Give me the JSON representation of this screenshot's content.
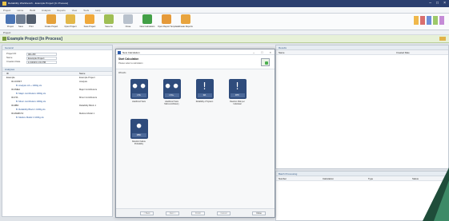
{
  "window": {
    "title": "Reliability Workbench - Example Project [In Process]",
    "controls": [
      "–",
      "□",
      "×"
    ]
  },
  "menu": [
    "Project",
    "Home",
    "Build",
    "Analysis",
    "Reports",
    "View",
    "Tools",
    "Help"
  ],
  "ribbon": {
    "buttons": [
      {
        "label": "Project",
        "color": "#4a74b4"
      },
      {
        "label": "Save",
        "color": "#6f7e92"
      },
      {
        "label": "Print",
        "color": "#545f6e"
      },
      {
        "label": "Create Project",
        "color": "#e5a23b"
      },
      {
        "label": "Open Project",
        "color": "#e3b84a"
      },
      {
        "label": "Save Project",
        "color": "#f0a93b"
      },
      {
        "label": "Save As",
        "color": "#9fbf55"
      },
      {
        "label": "Close",
        "color": "#b9c2cd"
      },
      {
        "label": "New Calculation",
        "color": "#43a047"
      },
      {
        "label": "Open Report Templates",
        "color": "#e59a3a"
      },
      {
        "label": "Create Reports",
        "color": "#e8a43e"
      }
    ],
    "right_swatches": [
      "#f0b84b",
      "#d96f6f",
      "#6f8fd9",
      "#9dc96a",
      "#c58bd6"
    ]
  },
  "breadcrumb": "Project",
  "project_header": "Example Project [In Process]",
  "left": {
    "section": "General",
    "fields": [
      {
        "label": "Project ID",
        "value": "001-PR"
      },
      {
        "label": "Name",
        "value": "Example Project"
      },
      {
        "label": "Creation Date",
        "value": "1/1/2023 1:01 PM"
      }
    ],
    "tree_section": "Analyses",
    "tree_cols": [
      "ID",
      "Name"
    ],
    "tree_rows": [
      {
        "id": "Example",
        "name": "Example Project",
        "indent": 0
      },
      {
        "id": "ID-CONST",
        "name": "Analysis",
        "indent": 1
      },
      {
        "id": "B. Analysis Lib + 1000g.xls",
        "name": "",
        "indent": 2
      },
      {
        "id": "ID-FMEA",
        "name": "Major Contributors",
        "indent": 1
      },
      {
        "id": "B. Major contributors 1000g.xls",
        "name": "",
        "indent": 2
      },
      {
        "id": "ID-FTA",
        "name": "Minor Contributors",
        "indent": 1
      },
      {
        "id": "B. Minor contributors 1000g.xls",
        "name": "",
        "indent": 2
      },
      {
        "id": "ID-RBD",
        "name": "Reliability Block 1",
        "indent": 1
      },
      {
        "id": "B. Reliability Block 1 1000g.xls",
        "name": "",
        "indent": 2
      },
      {
        "id": "ID-MARKOV",
        "name": "Markov Model 1",
        "indent": 1
      },
      {
        "id": "B. Markov Model 1 1000g.xls",
        "name": "",
        "indent": 2
      }
    ]
  },
  "results": {
    "section": "Results",
    "cols": [
      "Name",
      "Created Date"
    ]
  },
  "batch": {
    "section": "Batch Processing",
    "cols": [
      "Number",
      "Calculation",
      "Type",
      "Status"
    ]
  },
  "dialog": {
    "title": "New Calculation",
    "controls": [
      "–",
      "□",
      "×"
    ],
    "heading": "Start Calculation",
    "subheading": "Please select a calculation",
    "group_label": "Wizards",
    "tiles": [
      {
        "glyph": "⚫⚫",
        "sub": "LTA",
        "caption": "Likelihood Tests"
      },
      {
        "glyph": "⚫⚫",
        "sub": "LTA+",
        "caption": "Likelihood Tests Multi-contributory"
      },
      {
        "glyph": "!",
        "sub": "RA",
        "caption": "Reliability of System"
      },
      {
        "glyph": "!",
        "sub": "RTF",
        "caption": "Random Risk per Individual"
      },
      {
        "glyph": "⚫",
        "sub": "RBD",
        "caption": "Random Failure Probability"
      }
    ],
    "footer_buttons": [
      "< Back",
      "Next >",
      "Finish",
      "Cancel",
      "Close"
    ]
  }
}
